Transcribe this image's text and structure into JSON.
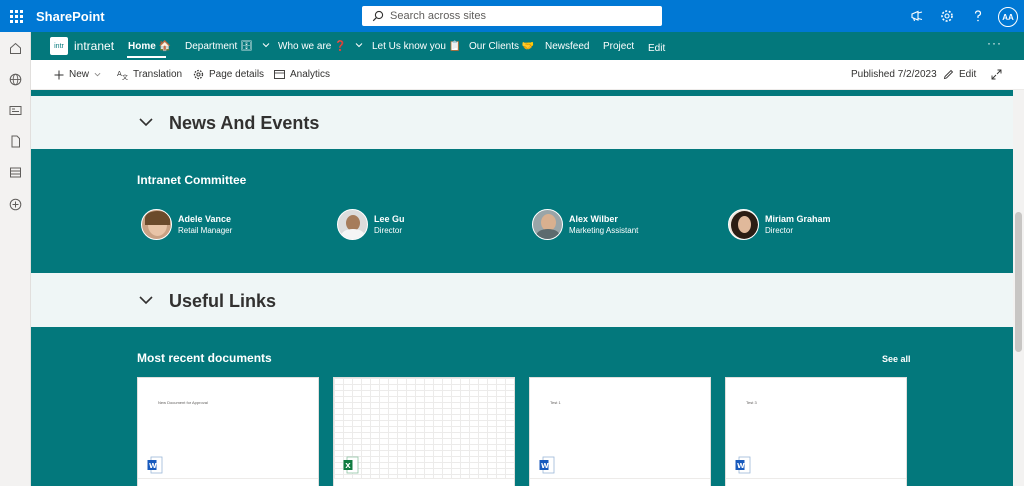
{
  "suite": {
    "app_name": "SharePoint",
    "search_placeholder": "Search across sites",
    "user_initials": "AA"
  },
  "site": {
    "logo_text": "intr",
    "name": "intranet",
    "nav": [
      {
        "label": "Home 🏠",
        "active": true
      },
      {
        "label": "Department 🗄",
        "dropdown": true
      },
      {
        "label": "Who we are ❓",
        "dropdown": true
      },
      {
        "label": "Let Us know you 📋"
      },
      {
        "label": "Our Clients 🤝"
      },
      {
        "label": "Newsfeed"
      },
      {
        "label": "Project"
      },
      {
        "label": "Edit"
      }
    ],
    "more": "···"
  },
  "commands": {
    "new": "New",
    "translation": "Translation",
    "page_details": "Page details",
    "analytics": "Analytics",
    "published": "Published 7/2/2023",
    "edit": "Edit"
  },
  "sections": {
    "news_events": "News And Events",
    "useful_links": "Useful Links"
  },
  "committee": {
    "title": "Intranet Committee",
    "people": [
      {
        "name": "Adele Vance",
        "title": "Retail Manager"
      },
      {
        "name": "Lee Gu",
        "title": "Director"
      },
      {
        "name": "Alex Wilber",
        "title": "Marketing Assistant"
      },
      {
        "name": "Miriam Graham",
        "title": "Director"
      }
    ]
  },
  "documents": {
    "title": "Most recent documents",
    "see_all": "See all",
    "items": [
      {
        "preview": "New Document for Approval",
        "type": "word"
      },
      {
        "preview": "",
        "type": "excel"
      },
      {
        "preview": "Test 1",
        "type": "word"
      },
      {
        "preview": "Test 3",
        "type": "word"
      }
    ]
  },
  "colors": {
    "suite_blue": "#0078d4",
    "theme_teal": "#03787c",
    "section_bg": "#eff6f6"
  }
}
